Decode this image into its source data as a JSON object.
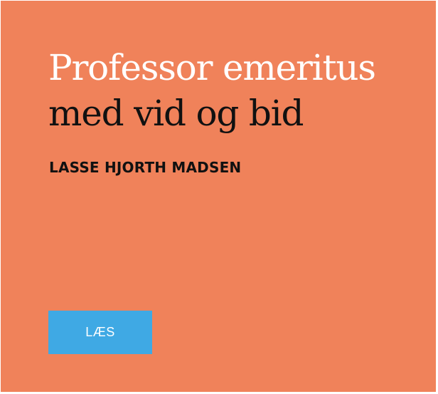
{
  "teaser": {
    "title_line_1": "Professor emeritus",
    "title_line_2": "med vid og bid",
    "author": "LASSE HJORTH MADSEN",
    "read_label": "LÆS"
  },
  "colors": {
    "background": "#f0825a",
    "title_accent": "#ffffff",
    "text_dark": "#111111",
    "button": "#3fa9e4",
    "button_text": "#ffffff"
  }
}
